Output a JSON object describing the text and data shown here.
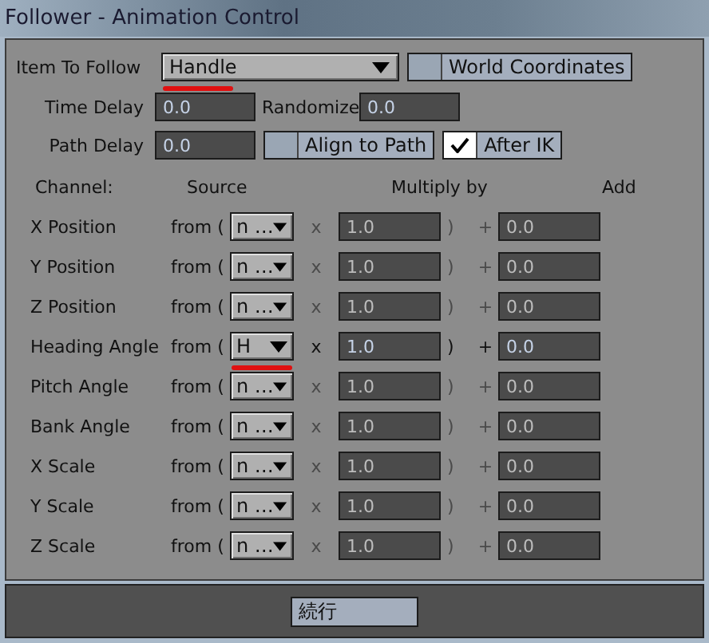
{
  "window": {
    "title": "Follower - Animation Control"
  },
  "item_to_follow": {
    "label": "Item To Follow",
    "value": "Handle",
    "highlighted": true
  },
  "world_coordinates": {
    "label": "World Coordinates",
    "checked": false
  },
  "time_delay": {
    "label": "Time Delay",
    "value": "0.0"
  },
  "randomize": {
    "label": "Randomize",
    "value": "0.0"
  },
  "path_delay": {
    "label": "Path Delay",
    "value": "0.0"
  },
  "options": [
    {
      "label": "Align to Path",
      "checked": false
    },
    {
      "label": "After IK",
      "checked": true
    }
  ],
  "headers": [
    "Channel:",
    "Source",
    "Multiply by",
    "Add"
  ],
  "channels": [
    {
      "name": "X Position",
      "from": "from (",
      "source": "n …",
      "times": "x",
      "multiply": "1.0",
      "close": ")",
      "plus": "+",
      "add": "0.0",
      "enabled": false,
      "highlighted": false
    },
    {
      "name": "Y Position",
      "from": "from (",
      "source": "n …",
      "times": "x",
      "multiply": "1.0",
      "close": ")",
      "plus": "+",
      "add": "0.0",
      "enabled": false,
      "highlighted": false
    },
    {
      "name": "Z Position",
      "from": "from (",
      "source": "n …",
      "times": "x",
      "multiply": "1.0",
      "close": ")",
      "plus": "+",
      "add": "0.0",
      "enabled": false,
      "highlighted": false
    },
    {
      "name": "Heading Angle",
      "from": "from (",
      "source": "H",
      "times": "x",
      "multiply": "1.0",
      "close": ")",
      "plus": "+",
      "add": "0.0",
      "enabled": true,
      "highlighted": true
    },
    {
      "name": "Pitch Angle",
      "from": "from (",
      "source": "n …",
      "times": "x",
      "multiply": "1.0",
      "close": ")",
      "plus": "+",
      "add": "0.0",
      "enabled": false,
      "highlighted": false
    },
    {
      "name": "Bank Angle",
      "from": "from (",
      "source": "n …",
      "times": "x",
      "multiply": "1.0",
      "close": ")",
      "plus": "+",
      "add": "0.0",
      "enabled": false,
      "highlighted": false
    },
    {
      "name": "X Scale",
      "from": "from (",
      "source": "n …",
      "times": "x",
      "multiply": "1.0",
      "close": ")",
      "plus": "+",
      "add": "0.0",
      "enabled": false,
      "highlighted": false
    },
    {
      "name": "Y Scale",
      "from": "from (",
      "source": "n …",
      "times": "x",
      "multiply": "1.0",
      "close": ")",
      "plus": "+",
      "add": "0.0",
      "enabled": false,
      "highlighted": false
    },
    {
      "name": "Z Scale",
      "from": "from (",
      "source": "n …",
      "times": "x",
      "multiply": "1.0",
      "close": ")",
      "plus": "+",
      "add": "0.0",
      "enabled": false,
      "highlighted": false
    }
  ],
  "footer": {
    "button": "続行"
  }
}
